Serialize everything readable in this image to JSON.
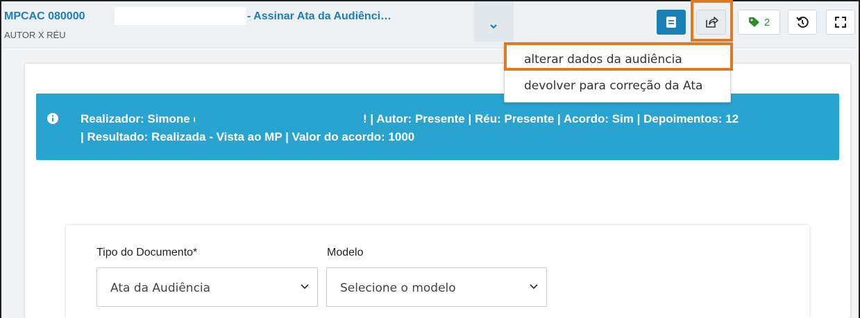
{
  "header": {
    "title_prefix": "MPCAC 080000",
    "title_suffix": "- Assinar Ata da Audiênci…",
    "subtitle": "AUTOR X RÉU",
    "tag_count": "2"
  },
  "menu": {
    "items": [
      {
        "label": "alterar dados da audiência"
      },
      {
        "label": "devolver para correção da Ata"
      }
    ]
  },
  "info": {
    "line1_start": "Realizador: Simone de /",
    "line1_end": "! | Autor: Presente | Réu: Presente | Acordo: Sim | Depoimentos: 12",
    "line2": "| Resultado: Realizada - Vista ao MP | Valor do acordo: 1000"
  },
  "form": {
    "tipo_label": "Tipo do Documento*",
    "tipo_value": "Ata da Audiência",
    "modelo_label": "Modelo",
    "modelo_value": "Selecione o modelo"
  },
  "colors": {
    "accent": "#1a7fb4",
    "info_bg": "#29a3cf",
    "highlight": "#e07a1f",
    "tag_green": "#2e8b2e"
  }
}
